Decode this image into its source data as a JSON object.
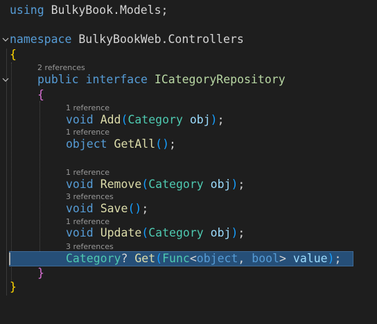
{
  "code": {
    "line1": {
      "kw": "using",
      "rest": "BulkyBook.Models;"
    },
    "line3": {
      "kw": "namespace",
      "rest": "BulkyBookWeb.Controllers"
    },
    "brace_open_ns": "{",
    "lens_interface": "2 references",
    "line_interface": {
      "kw1": "public",
      "kw2": "interface",
      "name": "ICategoryRepository"
    },
    "brace_open_iface": "{",
    "lens_add": "1 reference",
    "line_add": {
      "ret": "void",
      "name": "Add",
      "ptype": "Category",
      "pname": "obj",
      "end": ";"
    },
    "lens_getall": "1 reference",
    "line_getall": {
      "ret": "object",
      "name": "GetAll",
      "end": ";"
    },
    "lens_remove": "1 reference",
    "line_remove": {
      "ret": "void",
      "name": "Remove",
      "ptype": "Category",
      "pname": "obj",
      "end": ";"
    },
    "lens_save": "3 references",
    "line_save": {
      "ret": "void",
      "name": "Save",
      "end": ";"
    },
    "lens_update": "1 reference",
    "line_update": {
      "ret": "void",
      "name": "Update",
      "ptype": "Category",
      "pname": "obj",
      "end": ";"
    },
    "lens_get": "3 references",
    "line_get": {
      "ret": "Category",
      "nullable": "?",
      "name": "Get",
      "func": "Func",
      "lt": "<",
      "t1": "object",
      "comma": ",",
      "t2": "bool",
      "gt": ">",
      "pname": "value",
      "end": ";"
    },
    "brace_close_iface": "}",
    "brace_close_ns": "}"
  },
  "colors": {
    "background": "#1e1e1e",
    "keyword": "#569cd6",
    "type": "#4ec9b0",
    "interface": "#b8d7a3",
    "method": "#dcdcaa",
    "parameter": "#9cdcfe",
    "bracket_level1": "#ffd700",
    "bracket_level2": "#da70d6",
    "bracket_level3": "#179fff",
    "selection": "#264f78"
  },
  "icons": {
    "fold_namespace": "chevron-down-icon",
    "fold_interface": "chevron-down-icon"
  }
}
